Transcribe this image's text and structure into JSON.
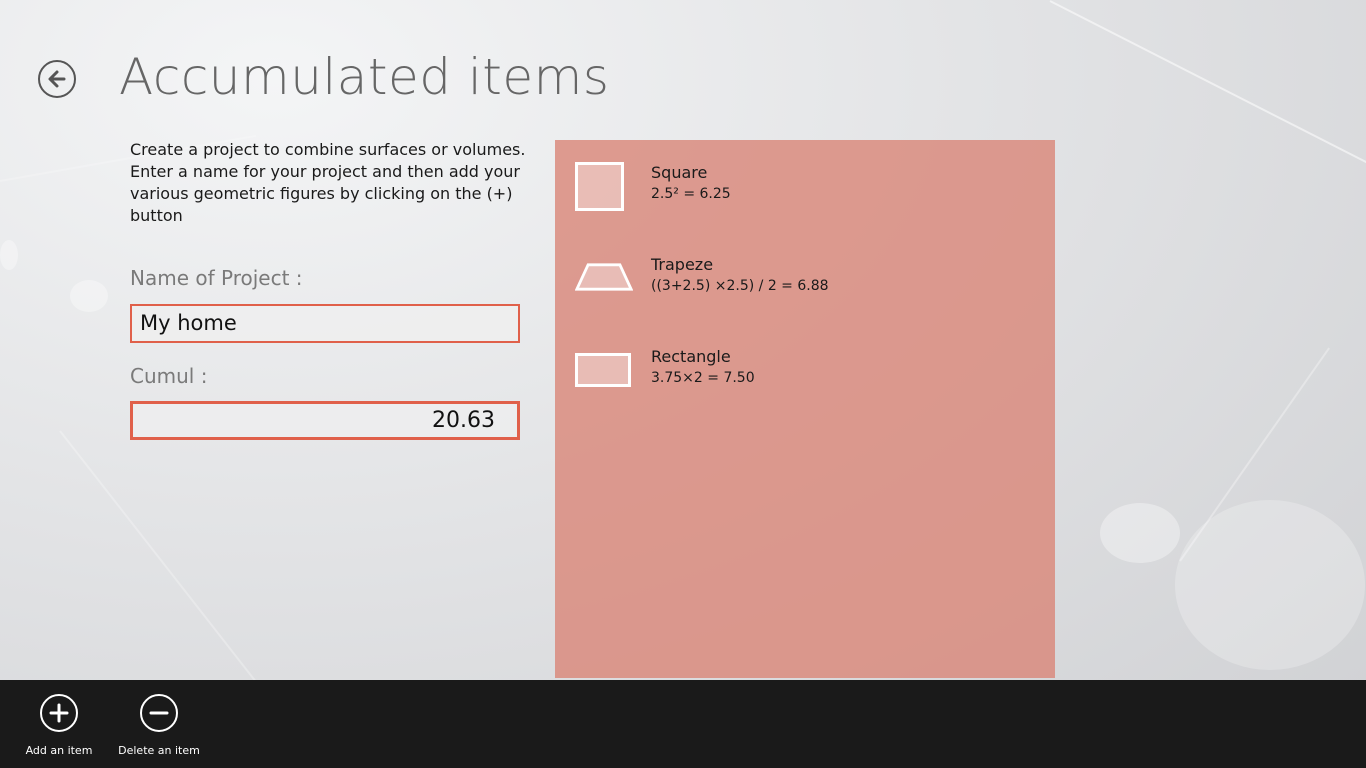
{
  "header": {
    "title": "Accumulated items",
    "back_icon": "back-arrow-icon"
  },
  "intro": {
    "text": "Create a project to combine surfaces or volumes. Enter a name for your project and then add your various geometric figures by clicking on the (+) button"
  },
  "form": {
    "project_label": "Name of Project :",
    "project_value": "My home",
    "cumul_label": "Cumul :",
    "cumul_value": "20.63"
  },
  "items": [
    {
      "name": "Square",
      "formula": "2.5² = 6.25",
      "icon": "square-icon"
    },
    {
      "name": "Trapeze",
      "formula": "((3+2.5) ×2.5) / 2 = 6.88",
      "icon": "trapeze-icon"
    },
    {
      "name": "Rectangle",
      "formula": "3.75×2 = 7.50",
      "icon": "rectangle-icon"
    }
  ],
  "appbar": {
    "add_label": "Add an item",
    "delete_label": "Delete an item"
  },
  "colors": {
    "accent_border": "#e0604a",
    "panel": "#d9877a",
    "appbar": "#1a1a1a"
  }
}
